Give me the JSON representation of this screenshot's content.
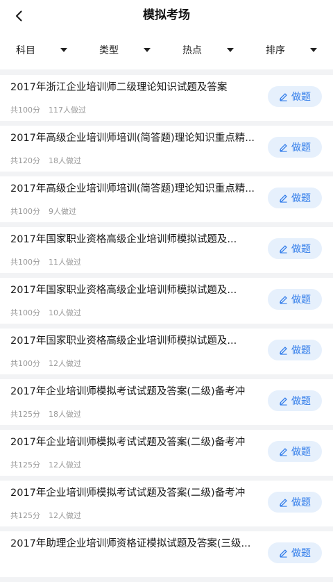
{
  "header": {
    "title": "模拟考场"
  },
  "filters": [
    {
      "label": "科目"
    },
    {
      "label": "类型"
    },
    {
      "label": "热点"
    },
    {
      "label": "排序"
    }
  ],
  "action_label": "做题",
  "exams": [
    {
      "title": "2017年浙江企业培训师二级理论知识试题及答案",
      "score": "共100分",
      "count": "117人做过"
    },
    {
      "title": "2017年高级企业培训师培训(简答题)理论知识重点精...",
      "score": "共120分",
      "count": "18人做过"
    },
    {
      "title": "2017年高级企业培训师培训(简答题)理论知识重点精...",
      "score": "共100分",
      "count": "9人做过"
    },
    {
      "title": "2017年国家职业资格高级企业培训师模拟试题及...",
      "score": "共100分",
      "count": "11人做过"
    },
    {
      "title": "2017年国家职业资格高级企业培训师模拟试题及...",
      "score": "共100分",
      "count": "10人做过"
    },
    {
      "title": "2017年国家职业资格高级企业培训师模拟试题及...",
      "score": "共100分",
      "count": "12人做过"
    },
    {
      "title": "2017年企业培训师模拟考试试题及答案(二级)备考冲",
      "score": "共125分",
      "count": "18人做过"
    },
    {
      "title": "2017年企业培训师模拟考试试题及答案(二级)备考冲",
      "score": "共125分",
      "count": "12人做过"
    },
    {
      "title": "2017年企业培训师模拟考试试题及答案(二级)备考冲",
      "score": "共125分",
      "count": "12人做过"
    },
    {
      "title": "2017年助理企业培训师资格证模拟试题及答案(三级...",
      "score": "",
      "count": ""
    }
  ],
  "colors": {
    "accent": "#2f7bea",
    "accent_bg": "#e6f0fc",
    "background": "#f2f3f5"
  },
  "icons": {
    "back": "chevron-left-icon",
    "action": "pencil-icon",
    "filter": "caret-down-icon"
  }
}
